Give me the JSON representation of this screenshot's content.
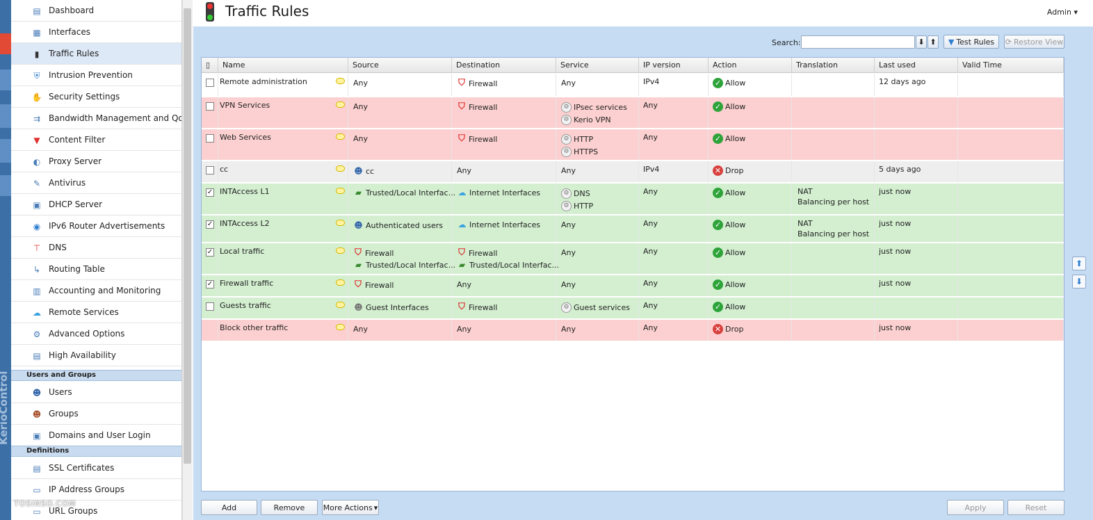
{
  "page": {
    "title": "Traffic Rules",
    "user": "Admin",
    "brand": "KerioControl",
    "watermark": "TOSINSO.COM"
  },
  "sidebar": {
    "items": [
      {
        "label": "Dashboard",
        "icon": "dashboard-icon"
      },
      {
        "label": "Interfaces",
        "icon": "interfaces-icon"
      },
      {
        "label": "Traffic Rules",
        "icon": "traffic-light-icon",
        "active": true
      },
      {
        "label": "Intrusion Prevention",
        "icon": "shield-icon"
      },
      {
        "label": "Security Settings",
        "icon": "stop-hand-icon"
      },
      {
        "label": "Bandwidth Management and QoS",
        "icon": "bandwidth-icon"
      },
      {
        "label": "Content Filter",
        "icon": "funnel-icon"
      },
      {
        "label": "Proxy Server",
        "icon": "proxy-icon"
      },
      {
        "label": "Antivirus",
        "icon": "syringe-icon"
      },
      {
        "label": "DHCP Server",
        "icon": "dhcp-icon"
      },
      {
        "label": "IPv6 Router Advertisements",
        "icon": "ipv6-icon"
      },
      {
        "label": "DNS",
        "icon": "dns-icon"
      },
      {
        "label": "Routing Table",
        "icon": "routing-icon"
      },
      {
        "label": "Accounting and Monitoring",
        "icon": "accounting-icon"
      },
      {
        "label": "Remote Services",
        "icon": "cloud-icon"
      },
      {
        "label": "Advanced Options",
        "icon": "gears-icon"
      },
      {
        "label": "High Availability",
        "icon": "high-availability-icon"
      }
    ],
    "section_users": "Users and Groups",
    "users_items": [
      {
        "label": "Users",
        "icon": "user-icon"
      },
      {
        "label": "Groups",
        "icon": "group-icon"
      },
      {
        "label": "Domains and User Login",
        "icon": "domain-icon"
      }
    ],
    "section_definitions": "Definitions",
    "def_items": [
      {
        "label": "SSL Certificates",
        "icon": "certificate-icon"
      },
      {
        "label": "IP Address Groups",
        "icon": "ip-group-icon"
      },
      {
        "label": "URL Groups",
        "icon": "url-group-icon"
      }
    ]
  },
  "toolbar": {
    "search_label": "Search:",
    "search_value": "",
    "test_rules": "Test Rules",
    "restore_view": "Restore View"
  },
  "grid": {
    "columns": [
      "Name",
      "Source",
      "Destination",
      "Service",
      "IP version",
      "Action",
      "Translation",
      "Last used",
      "Valid Time"
    ],
    "rows": [
      {
        "checked": false,
        "name": "Remote administration",
        "source": [
          {
            "t": "Any"
          }
        ],
        "destination": [
          {
            "t": "Firewall",
            "i": "fw"
          }
        ],
        "service": [
          {
            "t": "Any"
          }
        ],
        "ip": "IPv4",
        "action": "Allow",
        "translation": [],
        "last": "12 days ago",
        "color": "white"
      },
      {
        "checked": false,
        "name": "VPN Services",
        "source": [
          {
            "t": "Any"
          }
        ],
        "destination": [
          {
            "t": "Firewall",
            "i": "fw"
          }
        ],
        "service": [
          {
            "t": "IPsec services",
            "i": "svcg"
          },
          {
            "t": "Kerio VPN",
            "i": "svc"
          }
        ],
        "ip": "Any",
        "action": "Allow",
        "translation": [],
        "last": "",
        "color": "red"
      },
      {
        "checked": false,
        "name": "Web Services",
        "source": [
          {
            "t": "Any"
          }
        ],
        "destination": [
          {
            "t": "Firewall",
            "i": "fw"
          }
        ],
        "service": [
          {
            "t": "HTTP",
            "i": "svc"
          },
          {
            "t": "HTTPS",
            "i": "svc"
          }
        ],
        "ip": "Any",
        "action": "Allow",
        "translation": [],
        "last": "",
        "color": "red"
      },
      {
        "checked": false,
        "name": "cc",
        "source": [
          {
            "t": "cc",
            "i": "ui"
          }
        ],
        "destination": [
          {
            "t": "Any"
          }
        ],
        "service": [
          {
            "t": "Any"
          }
        ],
        "ip": "IPv4",
        "action": "Drop",
        "translation": [],
        "last": "5 days ago",
        "color": "gray"
      },
      {
        "checked": true,
        "name": "INTAccess L1",
        "source": [
          {
            "t": "Trusted/Local Interfac...",
            "i": "gi"
          }
        ],
        "destination": [
          {
            "t": "Internet Interfaces",
            "i": "ii"
          }
        ],
        "service": [
          {
            "t": "DNS",
            "i": "svc"
          },
          {
            "t": "HTTP",
            "i": "svc"
          }
        ],
        "ip": "Any",
        "action": "Allow",
        "translation": [
          "NAT",
          "Balancing per host"
        ],
        "last": "just now",
        "color": "green"
      },
      {
        "checked": true,
        "name": "INTAccess L2",
        "source": [
          {
            "t": "Authenticated users",
            "i": "ui"
          }
        ],
        "destination": [
          {
            "t": "Internet Interfaces",
            "i": "ii"
          }
        ],
        "service": [
          {
            "t": "Any"
          }
        ],
        "ip": "Any",
        "action": "Allow",
        "translation": [
          "NAT",
          "Balancing per host"
        ],
        "last": "just now",
        "color": "green"
      },
      {
        "checked": true,
        "name": "Local traffic",
        "source": [
          {
            "t": "Firewall",
            "i": "fw"
          },
          {
            "t": "Trusted/Local Interfac...",
            "i": "gi"
          }
        ],
        "destination": [
          {
            "t": "Firewall",
            "i": "fw"
          },
          {
            "t": "Trusted/Local Interfac...",
            "i": "gi"
          }
        ],
        "service": [
          {
            "t": "Any"
          }
        ],
        "ip": "Any",
        "action": "Allow",
        "translation": [],
        "last": "just now",
        "color": "green"
      },
      {
        "checked": true,
        "name": "Firewall traffic",
        "source": [
          {
            "t": "Firewall",
            "i": "fw"
          }
        ],
        "destination": [
          {
            "t": "Any"
          }
        ],
        "service": [
          {
            "t": "Any"
          }
        ],
        "ip": "Any",
        "action": "Allow",
        "translation": [],
        "last": "just now",
        "color": "green"
      },
      {
        "checked": false,
        "name": "Guests traffic",
        "source": [
          {
            "t": "Guest Interfaces",
            "i": "guest"
          }
        ],
        "destination": [
          {
            "t": "Firewall",
            "i": "fw"
          }
        ],
        "service": [
          {
            "t": "Guest services",
            "i": "svcg"
          }
        ],
        "ip": "Any",
        "action": "Allow",
        "translation": [],
        "last": "",
        "color": "green"
      },
      {
        "checked": null,
        "name": "Block other traffic",
        "source": [
          {
            "t": "Any"
          }
        ],
        "destination": [
          {
            "t": "Any"
          }
        ],
        "service": [
          {
            "t": "Any"
          }
        ],
        "ip": "Any",
        "action": "Drop",
        "translation": [],
        "last": "just now",
        "color": "red"
      }
    ]
  },
  "bottom": {
    "add": "Add",
    "remove": "Remove",
    "more_actions": "More Actions",
    "apply": "Apply",
    "reset": "Reset"
  },
  "colors": {
    "red_row": "#fcd0d0",
    "green_row": "#d3efd0",
    "gray_row": "#eeeeee",
    "content_bg": "#c5dcf3"
  }
}
